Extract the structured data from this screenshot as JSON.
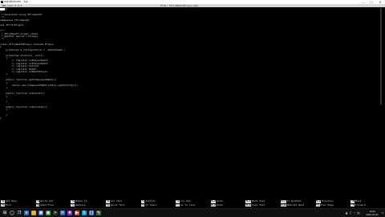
{
  "window": {
    "title": "user@ubuntu: ~/pj/…",
    "minimize_glyph": "—",
    "maximize_glyph": "☐",
    "close_glyph": "✕"
  },
  "editor_header": {
    "version": "GNU nano 2.9.3",
    "file": "File: IFireDeathPlugin.php"
  },
  "code_lines": [
    "<?php",
    "/*",
    " * Generated using IFireDeath",
    " */",
    "namespace IFireDeath;",
    "",
    "use IFire\\Plugin;",
    "",
    "/**",
    " * IFireDeath plugin class",
    " * @author secret citizens",
    " */",
    "",
    "class IFireDeathPlugin extends Plugin",
    "{",
    "    protected $_configuration = 'deathTheme';",
    "",
    "    protected function _init()",
    "    {",
    "        // register onPlayerDeath",
    "        // register onPlayerDeath",
    "        // register Fallout",
    "        // register Death",
    "        // register onDeathPlayer",
    "    }",
    "",
    "    public function getComponentMaker()",
    "    {",
    "        return new ComponentMaker($this->getConfig());",
    "    }",
    "",
    "    public function onInstall()",
    "    {",
    "",
    "    }",
    "",
    "    public function onUninstall()",
    "    {",
    "",
    "    }",
    "}"
  ],
  "shortcuts": [
    {
      "key": "^G",
      "label": "Get Help"
    },
    {
      "key": "^O",
      "label": "Write Out"
    },
    {
      "key": "^W",
      "label": "Where Is"
    },
    {
      "key": "^K",
      "label": "Cut Text"
    },
    {
      "key": "^J",
      "label": "Justify"
    },
    {
      "key": "^C",
      "label": "Cur Pos"
    },
    {
      "key": "M-U",
      "label": "Undo"
    },
    {
      "key": "M-A",
      "label": "Mark Text"
    },
    {
      "key": "M-]",
      "label": "To Bracket"
    },
    {
      "key": "M-Q",
      "label": "Previous"
    },
    {
      "key": "^B",
      "label": "Back"
    },
    {
      "key": "^X",
      "label": "Exit"
    },
    {
      "key": "^R",
      "label": "Read File"
    },
    {
      "key": "^\\",
      "label": "Replace"
    },
    {
      "key": "^U",
      "label": "Uncut Text"
    },
    {
      "key": "^T",
      "label": "To Spell"
    },
    {
      "key": "^_",
      "label": "Go To Line"
    },
    {
      "key": "M-E",
      "label": "Redo"
    },
    {
      "key": "M-6",
      "label": "Copy Text"
    },
    {
      "key": "M-W",
      "label": "WhereIs Next"
    },
    {
      "key": "^Y",
      "label": "Prev Page"
    },
    {
      "key": "^F",
      "label": "Forward"
    }
  ],
  "taskbar": {
    "icons": [
      {
        "name": "start",
        "glyph": "⊞",
        "color": "#1f1f1f"
      },
      {
        "name": "search",
        "glyph": "◯",
        "color": "#1f1f1f"
      },
      {
        "name": "taskview",
        "glyph": "❐",
        "color": "#1f1f1f"
      },
      {
        "name": "browser",
        "glyph": "e",
        "color": "#1f6fb5"
      },
      {
        "name": "folder",
        "glyph": "▭",
        "color": "#d9a520"
      },
      {
        "name": "store",
        "glyph": "▣",
        "color": "#2d6fd0"
      },
      {
        "name": "chrome",
        "glyph": "◉",
        "color": "#2e9e48"
      },
      {
        "name": "terminal",
        "glyph": ">",
        "color": "#2b2b2b"
      },
      {
        "name": "mail",
        "glyph": "✉",
        "color": "#1a6fc4"
      },
      {
        "name": "app",
        "glyph": "♦",
        "color": "#8a2be2"
      },
      {
        "name": "media",
        "glyph": "▶",
        "color": "#d24b2a"
      },
      {
        "name": "chat",
        "glyph": "S",
        "color": "#00a2e8"
      },
      {
        "name": "code",
        "glyph": "{}",
        "color": "#2c78bf"
      },
      {
        "name": "editor",
        "glyph": "✎",
        "color": "#3d6b3d"
      }
    ],
    "tray": [
      "▲",
      "♫",
      "⌁",
      "▤"
    ],
    "time": "12:00",
    "date": "2020-01-01",
    "notify_glyph": "▭"
  }
}
